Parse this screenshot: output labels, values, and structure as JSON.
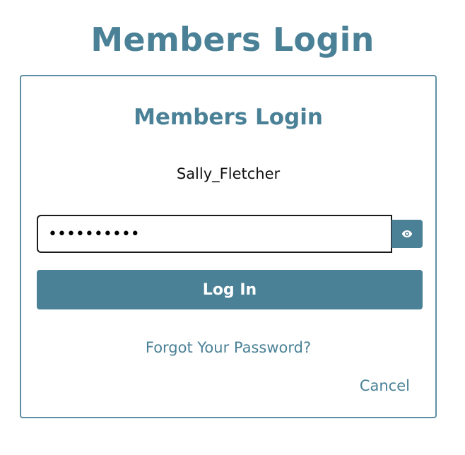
{
  "page": {
    "title": "Members Login"
  },
  "card": {
    "title": "Members Login",
    "username": "Sally_Fletcher",
    "password_value": "••••••••••",
    "login_label": "Log In",
    "forgot_label": "Forgot Your Password?",
    "cancel_label": "Cancel"
  },
  "icons": {
    "eye": "eye-icon"
  },
  "colors": {
    "accent": "#4a8196",
    "border": "#5f8fa3",
    "text": "#111111",
    "button_text": "#ffffff"
  }
}
